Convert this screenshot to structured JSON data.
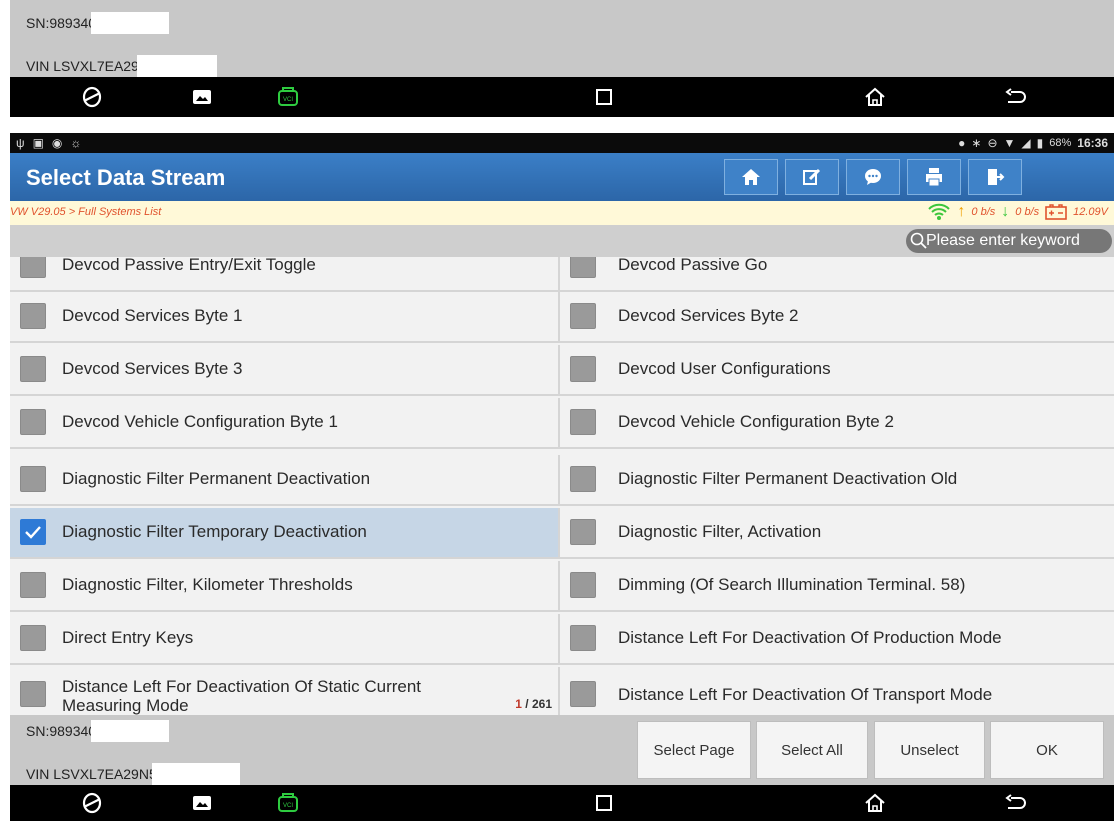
{
  "device": {
    "sn_top": "SN:989340",
    "vin_top": "VIN LSVXL7EA29",
    "sn_bottom": "SN:989340",
    "vin_bottom": "VIN LSVXL7EA29N5"
  },
  "navbar": {
    "icons": [
      "browser-icon",
      "gallery-icon",
      "vci-icon",
      "recents-icon",
      "home-icon",
      "back-icon"
    ]
  },
  "statusbar": {
    "battery": "68%",
    "time": "16:36"
  },
  "header": {
    "title": "Select Data Stream",
    "buttons": [
      "home-icon",
      "edit-icon",
      "message-icon",
      "print-icon",
      "exit-icon"
    ]
  },
  "breadcrumb": {
    "path": "VW V29.05 > Full Systems List",
    "upload": "0 b/s",
    "download": "0 b/s",
    "voltage": "12.09V"
  },
  "search": {
    "placeholder": "Please enter keyword"
  },
  "list": {
    "rows": [
      {
        "left": "Devcod Passive Entry/Exit Toggle",
        "right": "Devcod Passive Go"
      },
      {
        "left": "Devcod Services Byte 1",
        "right": "Devcod Services Byte 2"
      },
      {
        "left": "Devcod Services Byte 3",
        "right": "Devcod User Configurations"
      },
      {
        "left": "Devcod Vehicle Configuration Byte 1",
        "right": "Devcod Vehicle Configuration Byte 2"
      },
      {
        "left": "Diagnostic Filter Permanent Deactivation",
        "right": "Diagnostic Filter Permanent Deactivation Old"
      },
      {
        "left": "Diagnostic Filter Temporary Deactivation",
        "right": "Diagnostic Filter, Activation"
      },
      {
        "left": "Diagnostic Filter, Kilometer Thresholds",
        "right": "Dimming (Of Search Illumination Terminal. 58)"
      },
      {
        "left": "Direct Entry Keys",
        "right": "Distance Left For Deactivation Of Production Mode"
      },
      {
        "left": "Distance Left For Deactivation Of Static Current Measuring Mode",
        "right": "Distance Left For Deactivation Of Transport Mode"
      }
    ],
    "selected_left_row": 5,
    "page_current": "1",
    "page_total": "/ 261"
  },
  "actions": {
    "select_page": "Select Page",
    "select_all": "Select All",
    "unselect": "Unselect",
    "ok": "OK"
  },
  "colors": {
    "title_bar": "#2c66a8",
    "checked": "#2e7ad6",
    "accent_orange": "#e0522d",
    "wifi_green": "#3cc63c"
  }
}
